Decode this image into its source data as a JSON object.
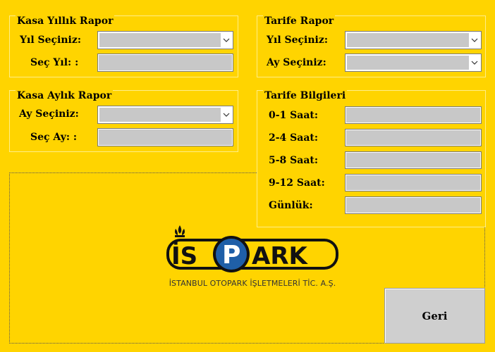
{
  "kasa_yillik": {
    "title": "Kasa Yıllık Rapor",
    "year_label": "Yıl Seçiniz:",
    "year_value": "",
    "selected_label": "Seç Yıl: :",
    "selected_value": ""
  },
  "kasa_aylik": {
    "title": "Kasa Aylık Rapor",
    "month_label": "Ay Seçiniz:",
    "month_value": "",
    "selected_label": "Seç Ay:  :",
    "selected_value": ""
  },
  "tarife_rapor": {
    "title": "Tarife Rapor",
    "year_label": "Yıl Seçiniz:",
    "year_value": "",
    "month_label": "Ay Seçiniz:",
    "month_value": ""
  },
  "tarife_bilgileri": {
    "title": "Tarife Bilgileri",
    "rows": [
      {
        "label": "0-1 Saat:",
        "value": ""
      },
      {
        "label": "2-4 Saat:",
        "value": ""
      },
      {
        "label": "5-8 Saat:",
        "value": ""
      },
      {
        "label": "9-12 Saat:",
        "value": ""
      },
      {
        "label": "Günlük:",
        "value": ""
      }
    ]
  },
  "logo": {
    "letters_left": "İS",
    "letter_p": "P",
    "letters_right": "ARK",
    "company": "İSTANBUL OTOPARK İŞLETMELERİ TİC. A.Ş."
  },
  "buttons": {
    "back_label": "Geri"
  },
  "icons": {
    "dropdown": "chevron-down-icon"
  },
  "colors": {
    "background": "#FFD400",
    "field": "#C8C8C8",
    "logo_blue": "#1F5FA8"
  }
}
